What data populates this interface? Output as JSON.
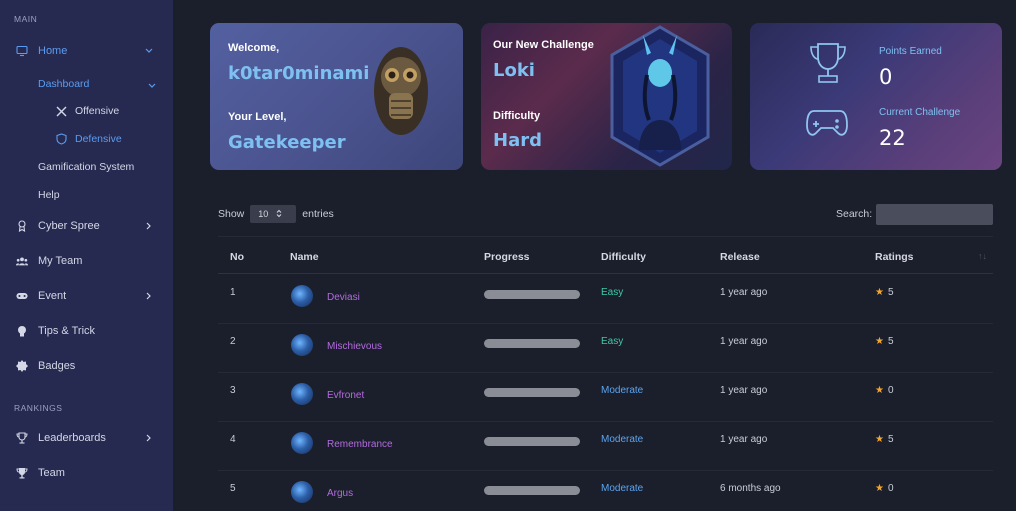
{
  "sidebar": {
    "main_label": "MAIN",
    "home": "Home",
    "dashboard": "Dashboard",
    "offensive": "Offensive",
    "defensive": "Defensive",
    "gamification": "Gamification System",
    "help": "Help",
    "cyber_spree": "Cyber Spree",
    "my_team": "My Team",
    "event": "Event",
    "tips": "Tips & Trick",
    "badges": "Badges",
    "rankings_label": "RANKINGS",
    "leaderboards": "Leaderboards",
    "team": "Team"
  },
  "welcome_card": {
    "welcome_label": "Welcome,",
    "username": "k0tar0minami",
    "level_label": "Your Level,",
    "level": "Gatekeeper"
  },
  "challenge_card": {
    "title_label": "Our New Challenge",
    "challenge_name": "Loki",
    "difficulty_label": "Difficulty",
    "difficulty": "Hard"
  },
  "stats_card": {
    "points_label": "Points Earned",
    "points": "0",
    "current_label": "Current Challenge",
    "current": "22"
  },
  "table_controls": {
    "show": "Show",
    "entries_value": "10",
    "entries": "entries",
    "search_label": "Search:"
  },
  "table": {
    "headers": [
      "No",
      "Name",
      "Progress",
      "Difficulty",
      "Release",
      "Ratings"
    ],
    "rows": [
      {
        "no": "1",
        "name": "Deviasi",
        "progress": 0,
        "difficulty": "Easy",
        "release": "1 year ago",
        "rating": "5"
      },
      {
        "no": "2",
        "name": "Mischievous",
        "progress": 0,
        "difficulty": "Easy",
        "release": "1 year ago",
        "rating": "5"
      },
      {
        "no": "3",
        "name": "Evfronet",
        "progress": 0,
        "difficulty": "Moderate",
        "release": "1 year ago",
        "rating": "0"
      },
      {
        "no": "4",
        "name": "Remembrance",
        "progress": 0,
        "difficulty": "Moderate",
        "release": "1 year ago",
        "rating": "5"
      },
      {
        "no": "5",
        "name": "Argus",
        "progress": 0,
        "difficulty": "Moderate",
        "release": "6 months ago",
        "rating": "0"
      }
    ]
  },
  "colors": {
    "easy": "#3ec9a7",
    "moderate": "#5ba4f0",
    "accent": "#5b9cf0",
    "name_link": "#b36be0",
    "star": "#f4a52a"
  },
  "icons": [
    "monitor-icon",
    "chevron-down-icon",
    "crossed-swords-icon",
    "shield-icon",
    "medal-icon",
    "users-icon",
    "gamepad-icon",
    "lightbulb-icon",
    "badge-icon",
    "trophy-icon",
    "chevron-right-icon",
    "star-icon",
    "sort-icon"
  ]
}
